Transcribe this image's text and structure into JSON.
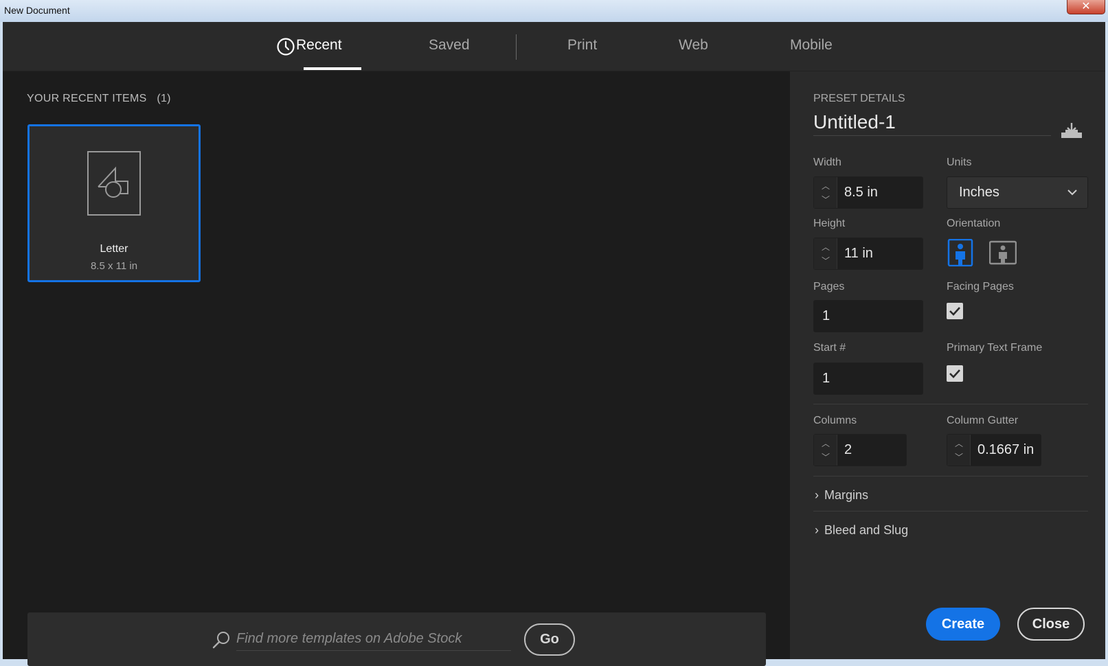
{
  "window": {
    "title": "New Document",
    "close_glyph": "✕"
  },
  "tabs": [
    {
      "label": "Recent",
      "icon": "clock-icon",
      "active": true
    },
    {
      "label": "Saved",
      "active": false
    },
    {
      "label": "Print",
      "active": false
    },
    {
      "label": "Web",
      "active": false
    },
    {
      "label": "Mobile",
      "active": false
    }
  ],
  "recent": {
    "heading": "YOUR RECENT ITEMS",
    "count": "(1)",
    "items": [
      {
        "name": "Letter",
        "size": "8.5 x 11 in",
        "icon": "document-shapes-icon",
        "selected": true
      }
    ]
  },
  "stock": {
    "placeholder": "Find more templates on Adobe Stock",
    "go_label": "Go"
  },
  "preset": {
    "heading": "PRESET DETAILS",
    "name": "Untitled-1",
    "width": {
      "label": "Width",
      "value": "8.5 in"
    },
    "units": {
      "label": "Units",
      "value": "Inches"
    },
    "height": {
      "label": "Height",
      "value": "11 in"
    },
    "orientation": {
      "label": "Orientation",
      "selected": "portrait"
    },
    "pages": {
      "label": "Pages",
      "value": "1"
    },
    "facing_pages": {
      "label": "Facing Pages",
      "checked": true
    },
    "start": {
      "label": "Start #",
      "value": "1"
    },
    "primary_text_frame": {
      "label": "Primary Text Frame",
      "checked": true
    },
    "columns": {
      "label": "Columns",
      "value": "2"
    },
    "column_gutter": {
      "label": "Column Gutter",
      "value": "0.1667 in"
    },
    "margins_label": "Margins",
    "bleed_label": "Bleed and Slug"
  },
  "actions": {
    "create_label": "Create",
    "close_label": "Close"
  },
  "colors": {
    "accent": "#1473e6",
    "panel": "#2a2a2a",
    "background": "#1c1c1c"
  }
}
